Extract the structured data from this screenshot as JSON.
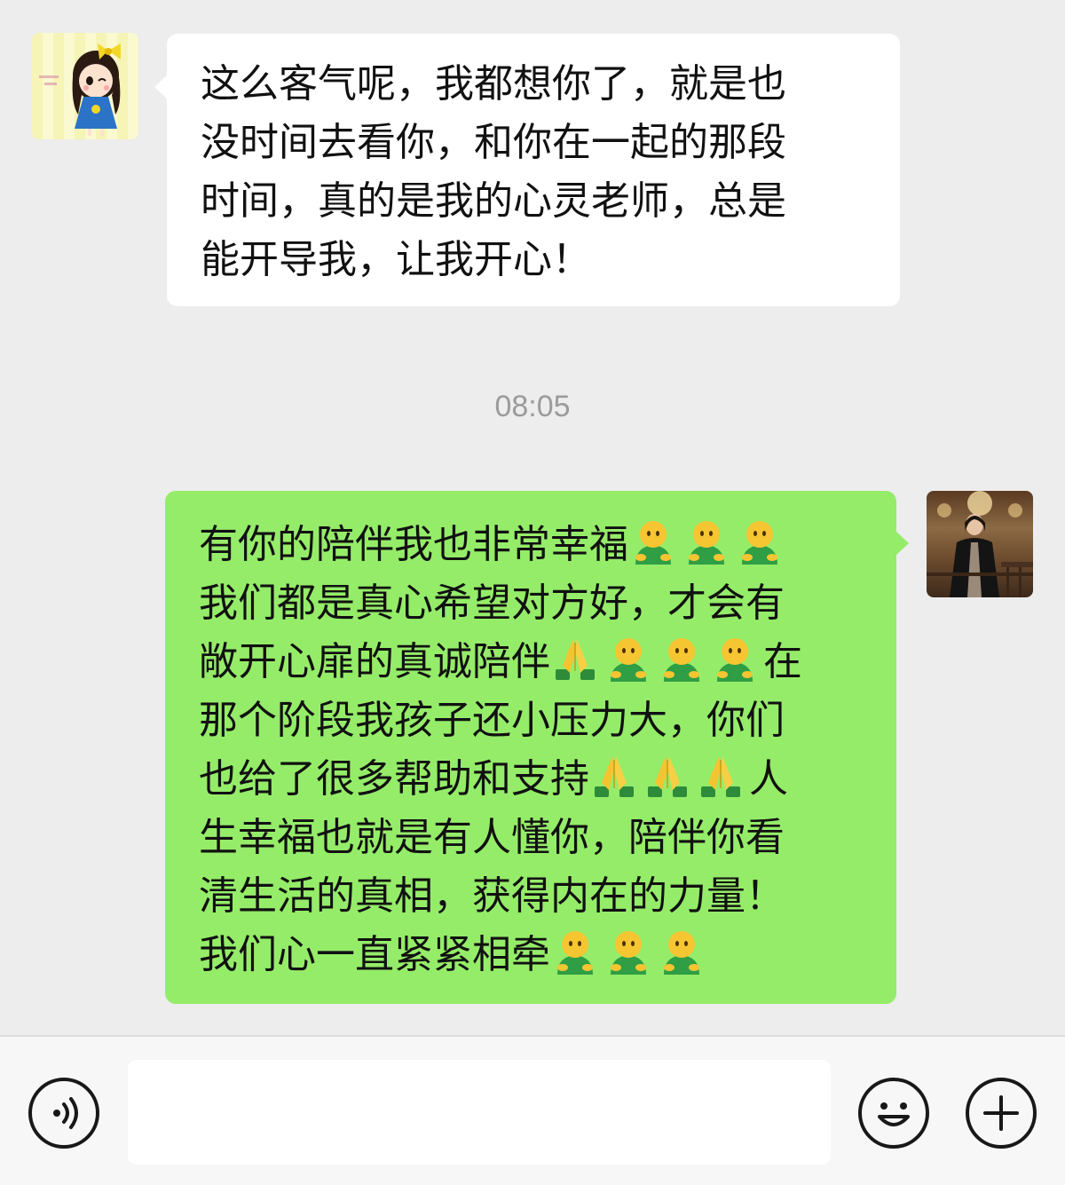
{
  "chat": {
    "messages": [
      {
        "side": "left",
        "sender": "contact",
        "avatar": "cartoon-girl-avatar",
        "bubble_color": "#ffffff",
        "lines": [
          "这么客气呢，我都想你了，就是也",
          "没时间去看你，和你在一起的那段",
          "时间，真的是我的心灵老师，总是",
          "能开导我，让我开心！"
        ]
      },
      {
        "side": "right",
        "sender": "self",
        "avatar": "woman-photo-avatar",
        "bubble_color": "#95ec69",
        "lines": [
          {
            "text_before": "有你的陪伴我也非常幸福",
            "emojis": [
              "hug-emoji",
              "hug-emoji",
              "hug-emoji"
            ],
            "text_after": ""
          },
          {
            "text_before": "我们都是真心希望对方好，才会有",
            "emojis": [],
            "text_after": ""
          },
          {
            "text_before": "敞开心扉的真诚陪伴",
            "emojis": [
              "pray-emoji",
              "hug-emoji",
              "hug-emoji",
              "hug-emoji"
            ],
            "text_after": "在"
          },
          {
            "text_before": "那个阶段我孩子还小压力大，你们",
            "emojis": [],
            "text_after": ""
          },
          {
            "text_before": "也给了很多帮助和支持",
            "emojis": [
              "pray-emoji",
              "pray-emoji",
              "pray-emoji"
            ],
            "text_after": "人"
          },
          {
            "text_before": "生幸福也就是有人懂你，陪伴你看",
            "emojis": [],
            "text_after": ""
          },
          {
            "text_before": "清生活的真相，获得内在的力量！",
            "emojis": [],
            "text_after": ""
          },
          {
            "text_before": "我们心一直紧紧相牵",
            "emojis": [
              "hug-emoji",
              "hug-emoji",
              "hug-emoji"
            ],
            "text_after": ""
          }
        ]
      }
    ],
    "timestamp": "08:05"
  },
  "input_bar": {
    "voice_icon": "voice-icon",
    "text_value": "",
    "emoji_icon": "smiley-icon",
    "more_icon": "plus-icon"
  },
  "colors": {
    "background": "#ededed",
    "sent_bubble": "#95ec69",
    "received_bubble": "#ffffff",
    "timestamp_text": "#9b9b9b"
  }
}
